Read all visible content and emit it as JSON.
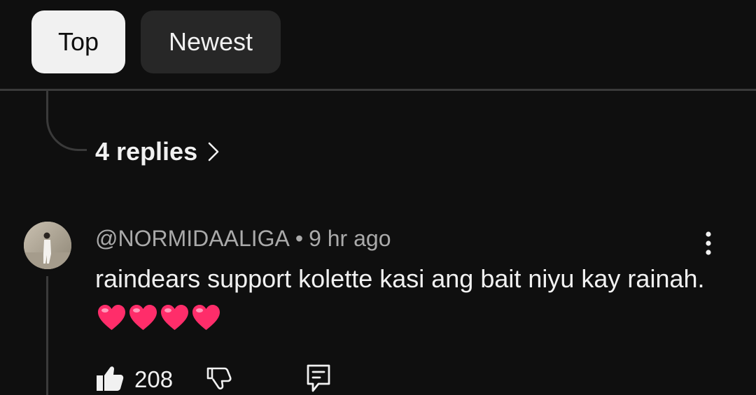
{
  "filters": {
    "top_label": "Top",
    "newest_label": "Newest"
  },
  "thread": {
    "replies_label": "4 replies"
  },
  "comment": {
    "author": "@NORMIDAALIGA",
    "separator": "•",
    "time": "9 hr ago",
    "text": "raindears support kolette kasi ang bait niyu kay rainah.",
    "emoji_count": 4,
    "emoji_name": "heart-emoji",
    "like_count": "208"
  },
  "colors": {
    "background": "#0f0f0f",
    "chip_active": "#f1f1f1",
    "chip_inactive": "#272727",
    "text_primary": "#f1f1f1",
    "text_secondary": "#aaaaaa",
    "heart": "#ff2d6a"
  },
  "icons": {
    "replies_chevron": "chevron-right-icon",
    "more": "more-vertical-icon",
    "like": "thumbs-up-icon",
    "dislike": "thumbs-down-icon",
    "reply": "reply-icon"
  }
}
